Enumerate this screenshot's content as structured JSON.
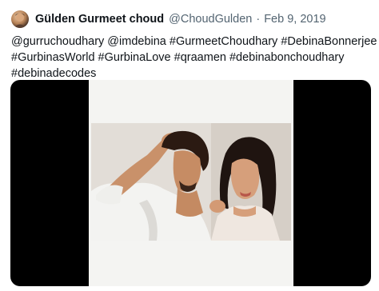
{
  "tweet": {
    "author_name": "Gülden Gurmeet choud",
    "handle": "@ChoudGulden",
    "separator": "·",
    "date": "Feb 9, 2019",
    "text_lines": [
      "@gurruchoudhary @imdebina #GurmeetChoudhary #DebinaBonnerjee",
      "#GurbinasWorld #GurbinaLove #qraamen #debinabonchoudhary",
      "#debinadecodes"
    ],
    "avatar": "profile-avatar-photo"
  },
  "media": {
    "type": "video-thumbnail",
    "description_icon": "photo-of-couple"
  },
  "colors": {
    "text_primary": "#0f1419",
    "text_secondary": "#536471",
    "media_background": "#000000"
  }
}
